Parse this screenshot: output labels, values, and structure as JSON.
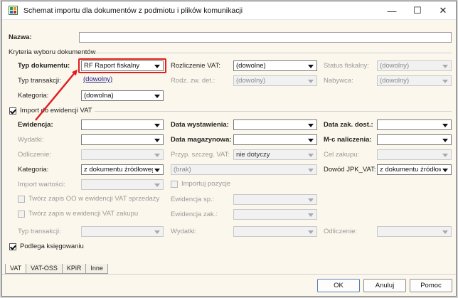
{
  "window": {
    "title": "Schemat importu dla dokumentów z podmiotu i plików komunikacji",
    "minimize": "—",
    "maximize": "☐",
    "close": "✕"
  },
  "nazwa": {
    "label": "Nazwa:",
    "value": ""
  },
  "kryteria": {
    "title": "Kryteria wyboru dokumentów",
    "typ_dokumentu": {
      "label": "Typ dokumentu:",
      "value": "RF Raport fiskalny"
    },
    "rozliczenie_vat": {
      "label": "Rozliczenie VAT:",
      "value": "(dowolne)"
    },
    "status_fiskalny": {
      "label": "Status fiskalny:",
      "value": "(dowolny)"
    },
    "typ_transakcji": {
      "label": "Typ transakcji:",
      "value": "(dowolny)"
    },
    "rodz_zw_det": {
      "label": "Rodz. zw. det.:",
      "value": "(dowolny)"
    },
    "nabywca": {
      "label": "Nabywca:",
      "value": "(dowolny)"
    },
    "kategoria": {
      "label": "Kategoria:",
      "value": "(dowolna)"
    }
  },
  "import_vat": {
    "label": "Import do ewidencji VAT",
    "checked": true,
    "ewidencja": {
      "label": "Ewidencja:",
      "value": ""
    },
    "data_wystawienia": {
      "label": "Data wystawienia:",
      "value": ""
    },
    "data_zak_dost": {
      "label": "Data zak. dost.:",
      "value": ""
    },
    "wydatki": {
      "label": "Wydatki:",
      "value": ""
    },
    "data_magazynowa": {
      "label": "Data magazynowa:",
      "value": ""
    },
    "mc_naliczenia": {
      "label": "M-c naliczenia:",
      "value": ""
    },
    "odliczenie": {
      "label": "Odliczenie:",
      "value": ""
    },
    "przyp_szczeg_vat": {
      "label": "Przyp. szczeg. VAT:",
      "value": "nie dotyczy"
    },
    "cel_zakupu": {
      "label": "Cel zakupu:",
      "value": ""
    },
    "kategoria": {
      "label": "Kategoria:",
      "value": "z dokumentu źródłowego"
    },
    "kategoria2": {
      "value": "(brak)"
    },
    "dowod_jpk_vat": {
      "label": "Dowód JPK_VAT:",
      "value": "z dokumentu źródłowe"
    },
    "import_wartosci": {
      "label": "Import wartości:",
      "value": ""
    },
    "importuj_pozycje": {
      "label": "Importuj pozycje",
      "checked": false
    },
    "tworz_oo_sprzedazy": {
      "label": "Twórz zapis OO w ewidencji VAT sprzedaży",
      "checked": false
    },
    "ewidencja_sp": {
      "label": "Ewidencja sp.:",
      "value": ""
    },
    "tworz_zakupu": {
      "label": "Twórz zapis w ewidencji VAT zakupu",
      "checked": false
    },
    "ewidencja_zak": {
      "label": "Ewidencja zak.:",
      "value": ""
    },
    "typ_transakcji": {
      "label": "Typ transakcji:",
      "value": ""
    },
    "wydatki2": {
      "label": "Wydatki:",
      "value": ""
    },
    "odliczenie2": {
      "label": "Odliczenie:",
      "value": ""
    }
  },
  "podlega_ksiegowaniu": {
    "label": "Podlega księgowaniu",
    "checked": true
  },
  "tabs": [
    "VAT",
    "VAT-OSS",
    "KPiR",
    "Inne"
  ],
  "buttons": {
    "ok": "OK",
    "anuluj": "Anuluj",
    "pomoc": "Pomoc"
  },
  "colors": {
    "highlight": "#e02020",
    "background": "#fbf7ec"
  }
}
